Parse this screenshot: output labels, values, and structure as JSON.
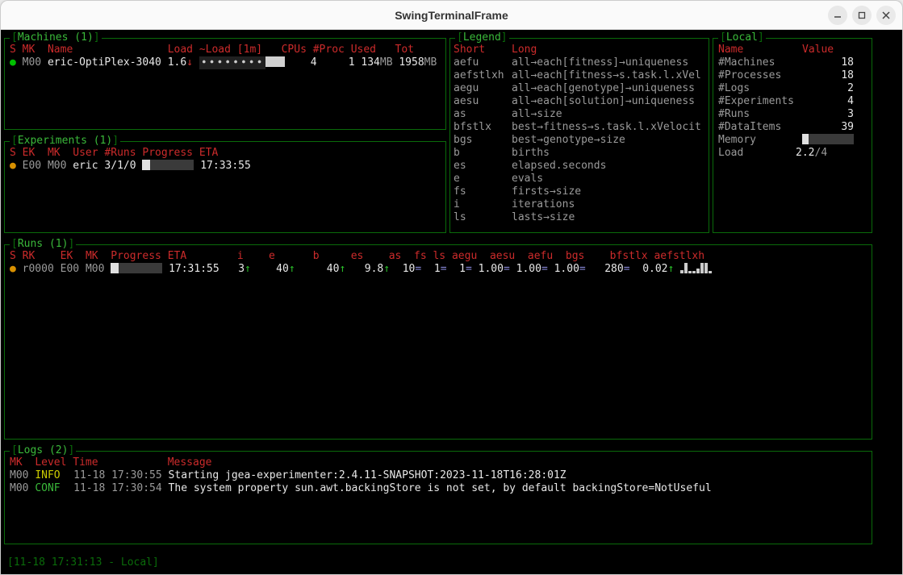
{
  "window": {
    "title": "SwingTerminalFrame"
  },
  "machines": {
    "title_prefix": "Machines (",
    "count": "1",
    "title_suffix": ")",
    "headers": {
      "s": "S",
      "mk": "MK",
      "name": "Name",
      "load": "Load",
      "loadm": "~Load [1m]",
      "cpus": "CPUs",
      "proc": "#Proc",
      "used": "Used",
      "tot": "Tot"
    },
    "rows": [
      {
        "status": "●",
        "mk": "M00",
        "name": "eric-OptiPlex-3040",
        "load": "1.6",
        "cpus": "4",
        "proc": "1",
        "used": "134",
        "used_unit": "MB",
        "tot": "1958",
        "tot_unit": "MB"
      }
    ]
  },
  "experiments": {
    "title_prefix": "Experiments (",
    "count": "1",
    "title_suffix": ")",
    "headers": {
      "s": "S",
      "ek": "EK",
      "mk": "MK",
      "user": "User",
      "runs": "#Runs",
      "progress": "Progress",
      "eta": "ETA"
    },
    "rows": [
      {
        "status": "●",
        "ek": "E00",
        "mk": "M00",
        "user": "eric",
        "runs": "3/1/0",
        "eta": "17:33:55"
      }
    ]
  },
  "legend": {
    "title": "Legend",
    "headers": {
      "short": "Short",
      "long": "Long"
    },
    "rows": [
      {
        "s": "aefu",
        "l": "all→each[fitness]→uniqueness"
      },
      {
        "s": "aefstlxh",
        "l": "all→each[fitness→s.task.l.xVel"
      },
      {
        "s": "aegu",
        "l": "all→each[genotype]→uniqueness"
      },
      {
        "s": "aesu",
        "l": "all→each[solution]→uniqueness"
      },
      {
        "s": "as",
        "l": "all→size"
      },
      {
        "s": "bfstlx",
        "l": "best→fitness→s.task.l.xVelocit"
      },
      {
        "s": "bgs",
        "l": "best→genotype→size"
      },
      {
        "s": "b",
        "l": "births"
      },
      {
        "s": "es",
        "l": "elapsed.seconds"
      },
      {
        "s": "e",
        "l": "evals"
      },
      {
        "s": "fs",
        "l": "firsts→size"
      },
      {
        "s": "i",
        "l": "iterations"
      },
      {
        "s": "ls",
        "l": "lasts→size"
      }
    ]
  },
  "local": {
    "title": "Local",
    "headers": {
      "name": "Name",
      "value": "Value"
    },
    "rows": [
      {
        "n": "#Machines",
        "v": "18"
      },
      {
        "n": "#Processes",
        "v": "18"
      },
      {
        "n": "#Logs",
        "v": "2"
      },
      {
        "n": "#Experiments",
        "v": "4"
      },
      {
        "n": "#Runs",
        "v": "3"
      },
      {
        "n": "#DataItems",
        "v": "39"
      }
    ],
    "memory_label": "Memory",
    "load_label": "Load",
    "load_value": "2.2",
    "load_sep": "/",
    "load_max": "4"
  },
  "runs": {
    "title_prefix": "Runs (",
    "count": "1",
    "title_suffix": ")",
    "headers": {
      "s": "S",
      "rk": "RK",
      "ek": "EK",
      "mk": "MK",
      "progress": "Progress",
      "eta": "ETA",
      "i": "i",
      "e": "e",
      "b": "b",
      "es": "es",
      "as": "as",
      "fs": "fs",
      "ls": "ls",
      "aegu": "aegu",
      "aesu": "aesu",
      "aefu": "aefu",
      "bgs": "bgs",
      "bfstlx": "bfstlx",
      "aefstlxh": "aefstlxh"
    },
    "rows": [
      {
        "status": "●",
        "rk": "r0000",
        "ek": "E00",
        "mk": "M00",
        "eta": "17:31:55",
        "i": "3",
        "e": "40",
        "b": "40",
        "es": "9.8",
        "as": "10",
        "fs": "1",
        "ls": "1",
        "aegu": "1.00",
        "aesu": "1.00",
        "aefu": "1.00",
        "bgs": "280",
        "bfstlx": "0.02"
      }
    ]
  },
  "logs": {
    "title_prefix": "Logs (",
    "count": "2",
    "title_suffix": ")",
    "headers": {
      "mk": "MK",
      "level": "Level",
      "time": "Time",
      "message": "Message"
    },
    "rows": [
      {
        "mk": "M00",
        "level": "INFO",
        "time": "11-18 17:30:55",
        "msg": "Starting jgea-experimenter:2.4.11-SNAPSHOT:2023-11-18T16:28:01Z"
      },
      {
        "mk": "M00",
        "level": "CONF",
        "time": "11-18 17:30:54",
        "msg": "The system property sun.awt.backingStore is not set, by default backingStore=NotUseful"
      }
    ]
  },
  "status_line": "[11-18 17:31:13 - Local]"
}
